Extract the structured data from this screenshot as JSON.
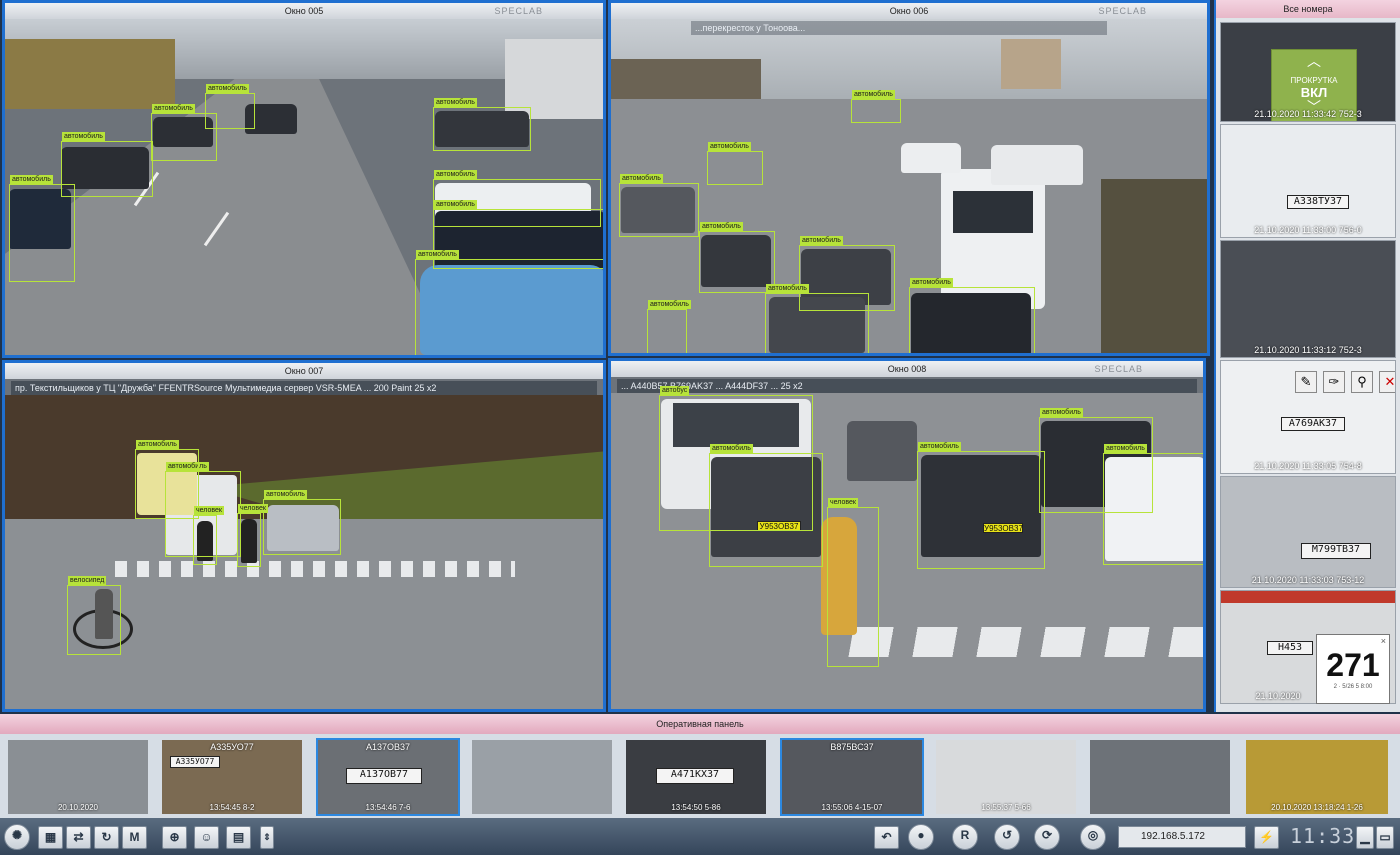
{
  "tiles": [
    {
      "title": "Окно 005",
      "brand": "SPECLAB",
      "info": ""
    },
    {
      "title": "Окно 006",
      "brand": "SPECLAB",
      "info": "...перекресток у Тоноова..."
    },
    {
      "title": "Окно 007",
      "brand": "",
      "info": "пр. Текстильщиков у ТЦ \"Дружба\"  FFENTRSource Мультимедиа сервер VSR-5MEA ... 200 Paint 25 x2"
    },
    {
      "title": "Окно 008",
      "brand": "SPECLAB",
      "info": "... A440B57 B769AK37 ... A444DF37 ... 25 x2"
    }
  ],
  "detections": {
    "t5": [
      "автомобиль",
      "автомобиль",
      "автомобиль",
      "автомобиль",
      "автомобиль",
      "автомобиль",
      "автомобиль",
      "автомобиль"
    ],
    "t6": [
      "автомобиль",
      "автомобиль",
      "автомобиль",
      "автомобиль",
      "автомобиль",
      "автомобиль",
      "автомобиль",
      "автомобиль"
    ],
    "t7": [
      "автомобиль",
      "автомобиль",
      "автомобиль",
      "человек",
      "человек",
      "велосипед"
    ],
    "t8": [
      "автобус",
      "автомобиль",
      "автомобиль",
      "автомобиль",
      "автомобиль",
      "человек"
    ]
  },
  "tile8_plates": [
    "У953ОВ37",
    "У953ОВ37"
  ],
  "strip": {
    "header": "Все номера",
    "scroll_label": "ПРОКРУТКА",
    "scroll_state": "ВКЛ",
    "shots": [
      {
        "plate": "",
        "time": "21.10.2020 11:33:42 752-3"
      },
      {
        "plate": "А338ТУ37",
        "time": "21.10.2020 11:33:00 756-0"
      },
      {
        "plate": "",
        "time": "21.10.2020 11:33:12 752-3"
      },
      {
        "plate": "А769АК37",
        "time": "21.10.2020 11:33:05 754-8"
      },
      {
        "plate": "М799ТВ37",
        "time": "21.10.2020 11:33:03 753-12"
      },
      {
        "plate": "Н453",
        "time": "21.10.2020"
      }
    ],
    "tools": [
      "✎",
      "✑",
      "⚲",
      "✕"
    ],
    "counter": "271",
    "counter_sub": "2 · 5/26 5 8:00"
  },
  "ops": {
    "header": "Оперативная панель",
    "thumbs": [
      {
        "top": "",
        "caption": "20.10.2020",
        "plate": ""
      },
      {
        "top": "А335УО77",
        "caption": "13:54:45 8-2",
        "plate": "А335УО77"
      },
      {
        "top": "А137ОВ37",
        "caption": "13:54:46 7-6",
        "plate": "А137ОВ77"
      },
      {
        "top": "",
        "caption": "",
        "plate": ""
      },
      {
        "top": "",
        "caption": "13:54:50 5-86",
        "plate": "А471КХ37"
      },
      {
        "top": "В875ВС37",
        "caption": "13:55:06 4-15-07",
        "plate": ""
      },
      {
        "top": "",
        "caption": "13:55:37 5-66",
        "plate": ""
      },
      {
        "top": "",
        "caption": "",
        "plate": ""
      },
      {
        "top": "",
        "caption": "20.10.2020 13:18:24 1-26",
        "plate": ""
      }
    ]
  },
  "toolbar": {
    "m_label": "M",
    "ip": "192.168.5.172",
    "clock": "11:33"
  },
  "colors": {
    "tile_border": "#1f6fd0",
    "detection": "#b7e33a",
    "panel_header": "#e7b7c8",
    "scroll_widget": "#8fb24d"
  }
}
